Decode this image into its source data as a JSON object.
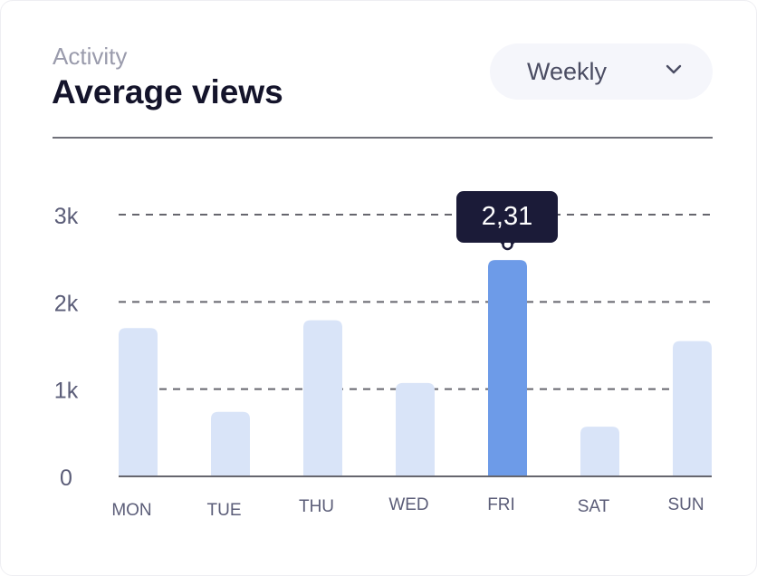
{
  "header": {
    "subtitle": "Activity",
    "title": "Average views"
  },
  "period_select": {
    "selected": "Weekly",
    "icon": "chevron-down-icon"
  },
  "tooltip": {
    "label": "2,31",
    "category": "FRI"
  },
  "colors": {
    "bar": "#d9e4f8",
    "bar_highlight": "#6d9be8",
    "grid": "#66666e",
    "tooltip_bg": "#1b1b38",
    "axis_text": "#5b5d78"
  },
  "chart_data": {
    "type": "bar",
    "categories": [
      "MON",
      "TUE",
      "THU",
      "WED",
      "FRI",
      "SAT",
      "SUN"
    ],
    "values": [
      1700,
      740,
      1790,
      1070,
      2480,
      570,
      1550
    ],
    "highlighted_index": 4,
    "title": "Average views",
    "xlabel": "",
    "ylabel": "",
    "ylim": [
      0,
      3000
    ],
    "yticks": [
      0,
      1000,
      2000,
      3000
    ],
    "ytick_labels": [
      "0",
      "1k",
      "2k",
      "3k"
    ],
    "grid": "horizontal-dashed",
    "legend": "none"
  }
}
